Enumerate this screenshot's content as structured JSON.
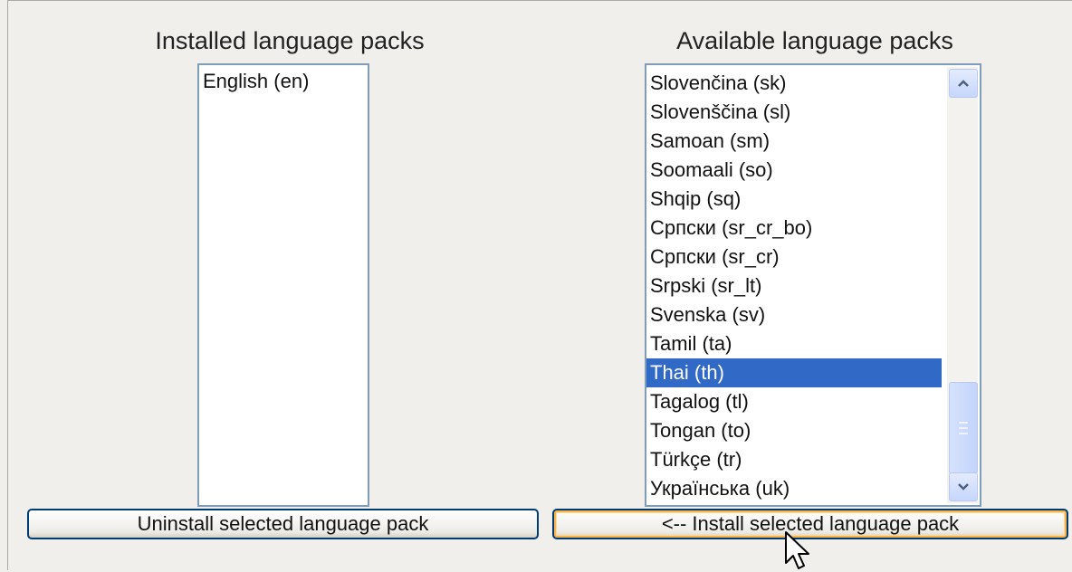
{
  "installed": {
    "heading": "Installed language packs",
    "items": [
      "English (en)"
    ]
  },
  "available": {
    "heading": "Available language packs",
    "selected": "Thai (th)",
    "items": [
      "Slovenčina (sk)",
      "Slovenščina (sl)",
      "Samoan (sm)",
      "Soomaali (so)",
      "Shqip (sq)",
      "Српски (sr_cr_bo)",
      "Српски (sr_cr)",
      "Srpski (sr_lt)",
      "Svenska (sv)",
      "Tamil (ta)",
      "Thai (th)",
      "Tagalog (tl)",
      "Tongan (to)",
      "Türkçe (tr)",
      "Українська (uk)"
    ]
  },
  "buttons": {
    "uninstall": "Uninstall selected language pack",
    "install": "<-- Install selected language pack"
  },
  "icons": {
    "scroll_up": "chevron-up-icon",
    "scroll_down": "chevron-down-icon",
    "cursor": "mouse-pointer-icon"
  },
  "colors": {
    "selection": "#3169c6",
    "button_border": "#003c74",
    "focus_ring": "#f8b34a"
  }
}
